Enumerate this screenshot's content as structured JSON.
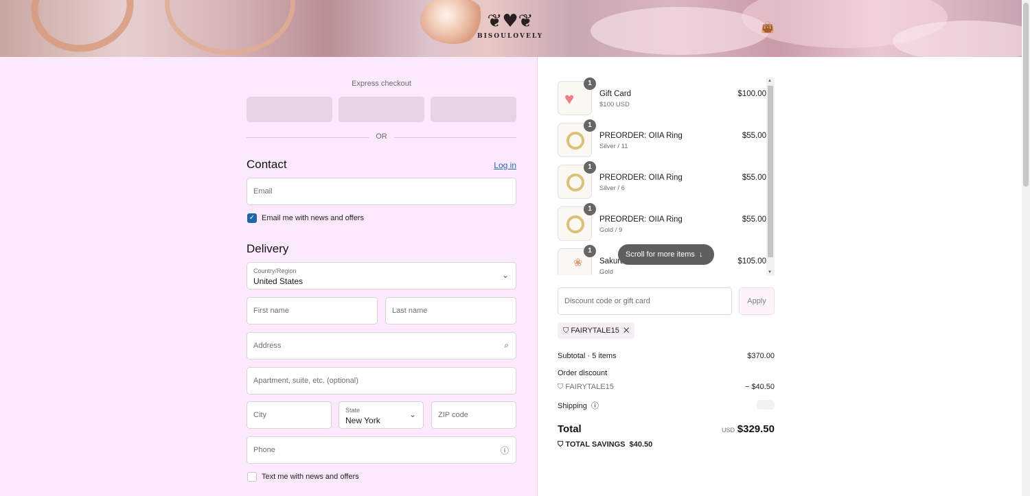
{
  "brand": {
    "name": "BISOULOVELY"
  },
  "express_checkout": {
    "title": "Express checkout",
    "or": "OR"
  },
  "contact": {
    "heading": "Contact",
    "login": "Log in",
    "email_placeholder": "Email",
    "news_label": "Email me with news and offers",
    "news_checked": true
  },
  "delivery": {
    "heading": "Delivery",
    "country_label": "Country/Region",
    "country_value": "United States",
    "first_name": "First name",
    "last_name": "Last name",
    "address": "Address",
    "apartment": "Apartment, suite, etc. (optional)",
    "city": "City",
    "state_label": "State",
    "state_value": "New York",
    "zip": "ZIP code",
    "phone": "Phone",
    "text_label": "Text me with news and offers",
    "text_checked": false
  },
  "cart": {
    "items": [
      {
        "qty": "1",
        "name": "Gift Card",
        "variant": "$100 USD",
        "price": "$100.00",
        "icon": "heart-gift-icon"
      },
      {
        "qty": "1",
        "name": "PREORDER: OIIA Ring",
        "variant": "Silver / 11",
        "price": "$55.00",
        "icon": "ring-icon"
      },
      {
        "qty": "1",
        "name": "PREORDER: OIIA Ring",
        "variant": "Silver / 6",
        "price": "$55.00",
        "icon": "ring-icon"
      },
      {
        "qty": "1",
        "name": "PREORDER: OIIA Ring",
        "variant": "Gold / 9",
        "price": "$55.00",
        "icon": "ring-icon"
      },
      {
        "qty": "1",
        "name": "Sakura",
        "variant": "Gold",
        "price": "$105.00",
        "icon": "necklace-icon"
      }
    ],
    "scroll_hint": "Scroll for more items",
    "discount_placeholder": "Discount code or gift card",
    "apply": "Apply",
    "applied_code": "FAIRYTALE15"
  },
  "summary": {
    "subtotal_label": "Subtotal · 5 items",
    "subtotal_value": "$370.00",
    "order_discount_label": "Order discount",
    "discount_code": "FAIRYTALE15",
    "discount_value": "− $40.50",
    "shipping_label": "Shipping",
    "total_label": "Total",
    "currency": "USD",
    "total_value": "$329.50",
    "savings_label": "TOTAL SAVINGS",
    "savings_value": "$40.50"
  },
  "colors": {
    "left_bg": "#fde9fd",
    "accent": "#2165a8",
    "link": "#1f67b0"
  }
}
